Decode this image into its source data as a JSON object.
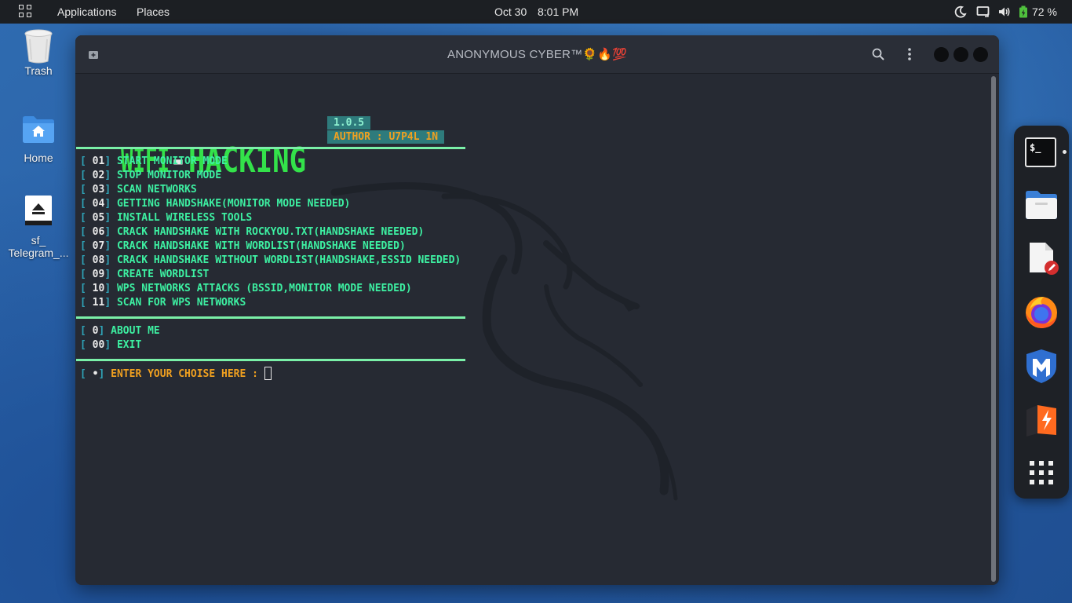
{
  "topbar": {
    "applications": "Applications",
    "places": "Places",
    "date": "Oct 30",
    "time": "8:01 PM",
    "battery": "72 %",
    "icons": [
      "grid-icon",
      "moon-icon",
      "display-icon",
      "volume-icon",
      "battery-icon"
    ]
  },
  "desktop": {
    "trash_label": "Trash",
    "home_label": "Home",
    "drive_label_1": "sf_",
    "drive_label_2": "Telegram_..."
  },
  "window": {
    "title": "ANONYMOUS CYBER™🌻🔥💯",
    "icons": [
      "new-tab-icon",
      "search-icon",
      "kebab-menu-icon",
      "minimize-dot",
      "maximize-dot",
      "close-dot"
    ]
  },
  "terminal": {
    "banner_part1": "WIFI",
    "banner_dash": "-",
    "banner_part2": "HACKING",
    "version": "1.0.5",
    "author": "AUTHOR : U7P4L 1N",
    "menu": [
      {
        "num": "01",
        "label": "START MONITOR MODE"
      },
      {
        "num": "02",
        "label": "STOP MONITOR MODE"
      },
      {
        "num": "03",
        "label": "SCAN NETWORKS"
      },
      {
        "num": "04",
        "label": "GETTING HANDSHAKE(MONITOR MODE NEEDED)"
      },
      {
        "num": "05",
        "label": "INSTALL WIRELESS TOOLS"
      },
      {
        "num": "06",
        "label": "CRACK HANDSHAKE WITH ROCKYOU.TXT(HANDSHAKE NEEDED)"
      },
      {
        "num": "07",
        "label": "CRACK HANDSHAKE WITH WORDLIST(HANDSHAKE NEEDED)"
      },
      {
        "num": "08",
        "label": "CRACK HANDSHAKE WITHOUT WORDLIST(HANDSHAKE,ESSID NEEDED)"
      },
      {
        "num": "09",
        "label": "CREATE WORDLIST"
      },
      {
        "num": "10",
        "label": "WPS NETWORKS ATTACKS (BSSID,MONITOR MODE NEEDED)"
      },
      {
        "num": "11",
        "label": "SCAN FOR WPS NETWORKS"
      }
    ],
    "extra": [
      {
        "num": "0",
        "label": "ABOUT ME"
      },
      {
        "num": "00",
        "label": "EXIT"
      }
    ],
    "prompt_marker": "•",
    "prompt": "ENTER YOUR CHOISE HERE : "
  },
  "dock": {
    "items": [
      "terminal-icon",
      "files-icon",
      "text-editor-icon",
      "firefox-icon",
      "metasploit-icon",
      "burpsuite-icon",
      "app-grid-icon"
    ],
    "terminal_glyph": "$_"
  },
  "colors": {
    "menu_green": "#3df0a2",
    "banner_green": "#33e24a",
    "accent_orange": "#f0a020",
    "bracket_cyan": "#2fa4b8",
    "terminal_bg": "#262a33"
  }
}
